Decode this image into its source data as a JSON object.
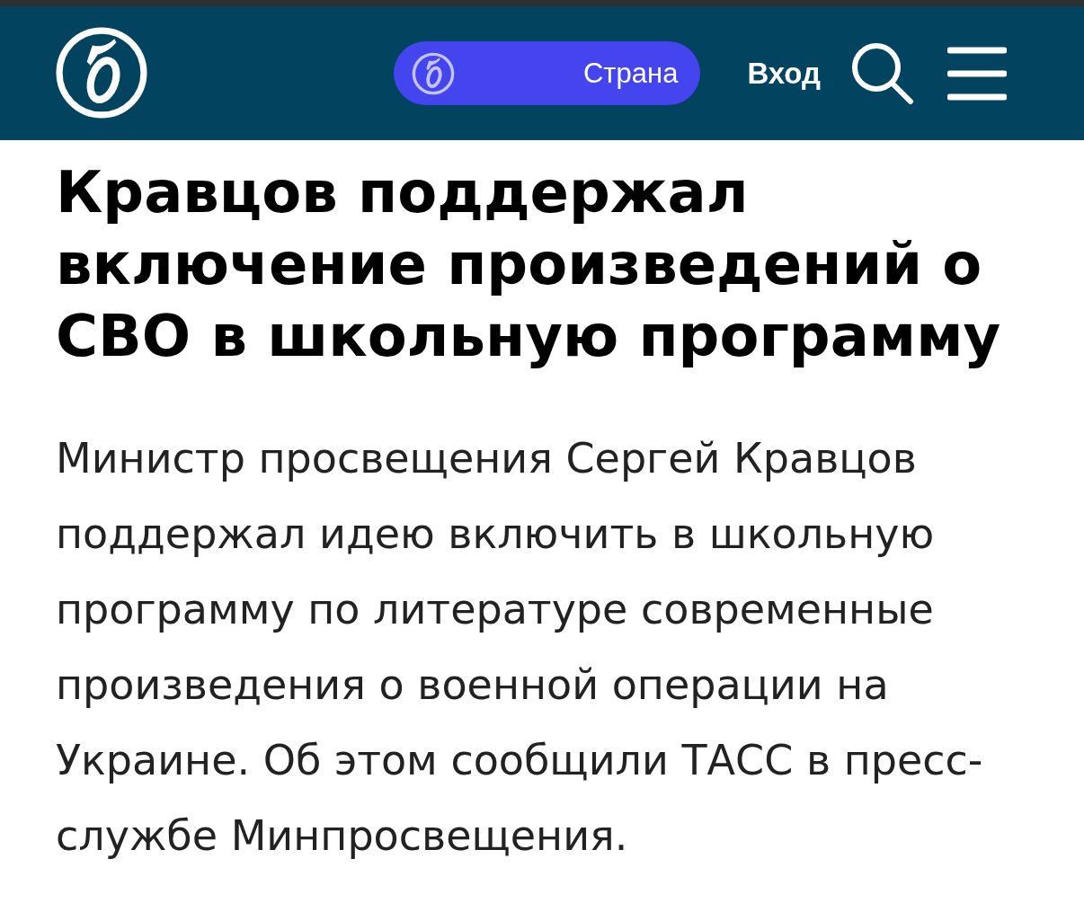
{
  "header": {
    "section_button": {
      "label": "Страна"
    },
    "login": {
      "label": "Вход"
    }
  },
  "article": {
    "title": "Кравцов поддержал включение произведений о СВО в школьную программу",
    "lead": "Министр просвещения Сергей Кравцов поддержал идею включить в школьную программу по литературе современные произведения о военной операции на Украине. Об этом сообщили ТАСС в пресс-службе Минпросвещения."
  }
}
